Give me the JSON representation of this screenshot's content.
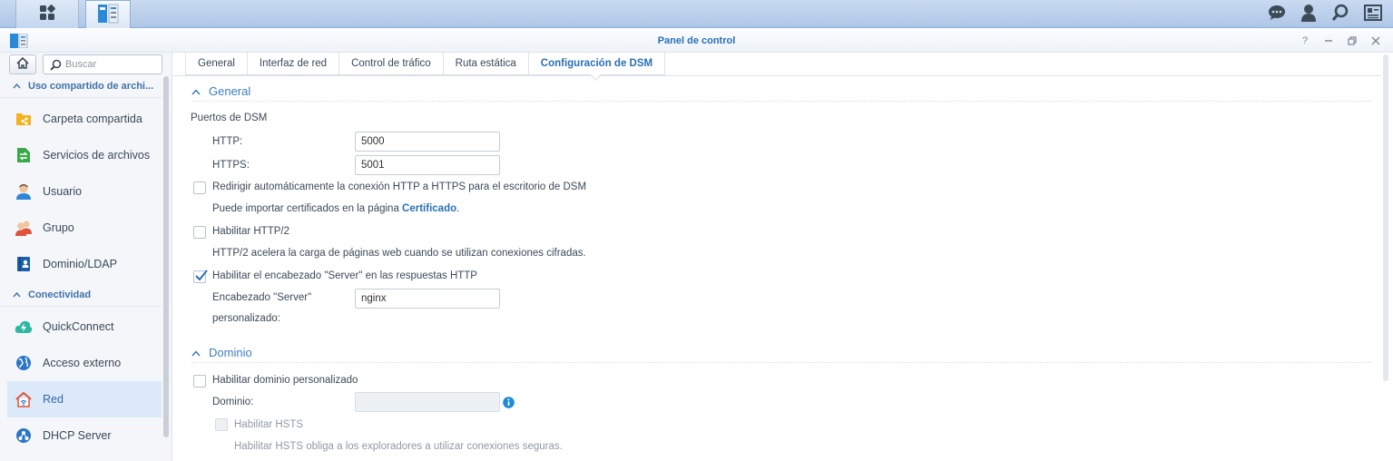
{
  "taskbar": {
    "icons": [
      "apps-grid-icon",
      "control-panel-icon",
      "chat-icon",
      "user-icon",
      "search-icon",
      "widgets-icon"
    ]
  },
  "window": {
    "title": "Panel de control",
    "controls": [
      "help-icon",
      "minimize-icon",
      "restore-icon",
      "close-icon"
    ]
  },
  "sidebar": {
    "search_placeholder": "Buscar",
    "sections": [
      {
        "label": "Uso compartido de archi..."
      },
      {
        "label": "Conectividad"
      }
    ],
    "items": [
      {
        "label": "Carpeta compartida",
        "icon": "shared-folder-icon"
      },
      {
        "label": "Servicios de archivos",
        "icon": "file-services-icon"
      },
      {
        "label": "Usuario",
        "icon": "user-icon"
      },
      {
        "label": "Grupo",
        "icon": "group-icon"
      },
      {
        "label": "Dominio/LDAP",
        "icon": "domain-ldap-icon"
      },
      {
        "label": "QuickConnect",
        "icon": "quickconnect-icon"
      },
      {
        "label": "Acceso externo",
        "icon": "external-access-icon"
      },
      {
        "label": "Red",
        "icon": "network-icon",
        "active": true
      },
      {
        "label": "DHCP Server",
        "icon": "dhcp-icon"
      }
    ]
  },
  "tabs": [
    {
      "label": "General"
    },
    {
      "label": "Interfaz de red"
    },
    {
      "label": "Control de tráfico"
    },
    {
      "label": "Ruta estática"
    },
    {
      "label": "Configuración de DSM",
      "active": true
    }
  ],
  "general": {
    "heading": "General",
    "ports_label": "Puertos de DSM",
    "http_label": "HTTP:",
    "http_value": "5000",
    "https_label": "HTTPS:",
    "https_value": "5001",
    "redirect_label": "Redirigir automáticamente la conexión HTTP a HTTPS para el escritorio de DSM",
    "redirect_checked": false,
    "cert_text": "Puede importar certificados en la página ",
    "cert_link": "Certificado",
    "cert_end": ".",
    "http2_label": "Habilitar HTTP/2",
    "http2_checked": false,
    "http2_desc": "HTTP/2 acelera la carga de páginas web cuando se utilizan conexiones cifradas.",
    "server_header_label": "Habilitar el encabezado \"Server\" en las respuestas HTTP",
    "server_header_checked": true,
    "custom_header_label_1": "Encabezado \"Server\"",
    "custom_header_label_2": "personalizado:",
    "custom_header_value": "nginx"
  },
  "domain": {
    "heading": "Dominio",
    "custom_domain_label": "Habilitar dominio personalizado",
    "custom_domain_checked": false,
    "domain_label": "Dominio:",
    "domain_value": "",
    "hsts_label": "Habilitar HSTS",
    "hsts_checked": false,
    "hsts_desc": "Habilitar HSTS obliga a los exploradores a utilizar conexiones seguras."
  }
}
